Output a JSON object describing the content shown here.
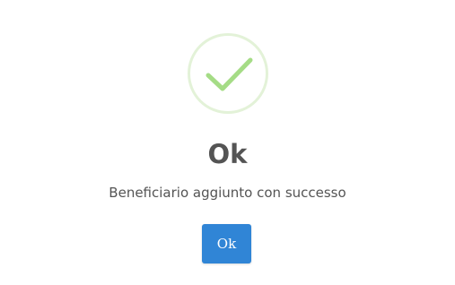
{
  "dialog": {
    "icon": "checkmark-success-icon",
    "title": "Ok",
    "message": "Beneficiario aggiunto con successo",
    "confirm_label": "Ok"
  },
  "colors": {
    "accent": "#3085d6",
    "success_check": "#a5dc86",
    "success_ring": "#e3f2d8",
    "text": "#545454"
  }
}
